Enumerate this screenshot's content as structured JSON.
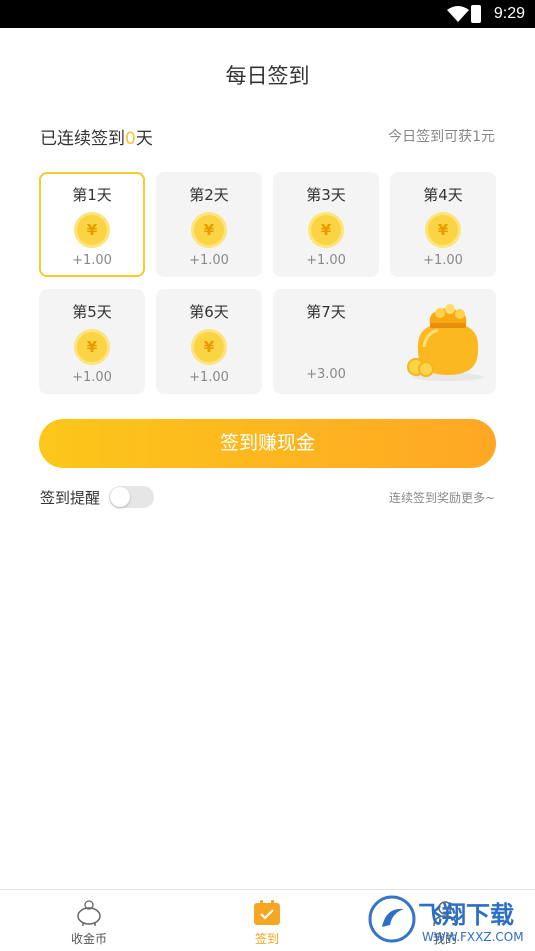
{
  "status_bar": {
    "time": "9:29"
  },
  "page": {
    "title": "每日签到"
  },
  "streak": {
    "prefix": "已连续签到",
    "count": "0",
    "suffix": "天"
  },
  "today_reward": "今日签到可获1元",
  "days": [
    {
      "label": "第1天",
      "amount": "+1.00",
      "active": true
    },
    {
      "label": "第2天",
      "amount": "+1.00"
    },
    {
      "label": "第3天",
      "amount": "+1.00"
    },
    {
      "label": "第4天",
      "amount": "+1.00"
    },
    {
      "label": "第5天",
      "amount": "+1.00"
    },
    {
      "label": "第6天",
      "amount": "+1.00"
    },
    {
      "label": "第7天",
      "amount": "+3.00"
    }
  ],
  "coin_symbol": "¥",
  "sign_button": "签到赚现金",
  "reminder": {
    "label": "签到提醒",
    "enabled": false
  },
  "more_rewards": "连续签到奖励更多~",
  "nav": [
    {
      "label": "收金币",
      "icon": "piggy-bank-icon"
    },
    {
      "label": "签到",
      "icon": "calendar-check-icon",
      "active": true
    },
    {
      "label": "我的",
      "icon": "user-icon"
    }
  ],
  "watermark": {
    "text": "飞翔下载",
    "url": "WWW.FXXZ.COM"
  },
  "colors": {
    "accent": "#f7c52b",
    "button_start": "#fcc71a",
    "button_end": "#ffa724",
    "nav_active": "#f4a31e"
  }
}
